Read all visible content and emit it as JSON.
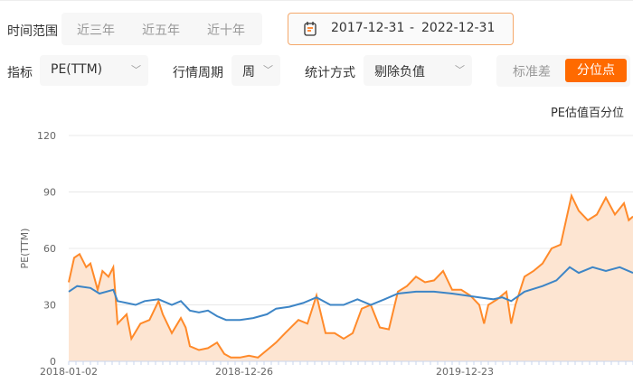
{
  "filters": {
    "time_range_label": "时间范围",
    "range_options": [
      "近三年",
      "近五年",
      "近十年"
    ],
    "date_start": "2017-12-31",
    "date_sep": "-",
    "date_end": "2022-12-31",
    "calendar_icon": "calendar-icon",
    "indicator_label": "指标",
    "indicator_value": "PE(TTM)",
    "period_label": "行情周期",
    "period_value": "周",
    "stat_label": "统计方式",
    "stat_value": "剔除负值",
    "toggle_options": [
      "标准差",
      "分位点"
    ],
    "toggle_active": "分位点"
  },
  "colors": {
    "accent": "#ff6a00",
    "pe": "#3d85c6",
    "percentile": "#ff8a2a",
    "fill": "#fde5d2"
  },
  "chart_data": {
    "type": "line",
    "title": "PE估值百分位",
    "ylabel": "PE(TTM)",
    "ylim": [
      0,
      120
    ],
    "yticks": [
      0,
      30,
      60,
      90,
      120
    ],
    "xlim": [
      0,
      936
    ],
    "xticks": [
      {
        "x": 0,
        "label": "2018-01-02"
      },
      {
        "x": 291,
        "label": "2018-12-26"
      },
      {
        "x": 657,
        "label": "2019-12-23"
      }
    ],
    "series": [
      {
        "name": "PE估值百分位",
        "type": "area",
        "points": [
          [
            0,
            42
          ],
          [
            9,
            55
          ],
          [
            18,
            57
          ],
          [
            29,
            50
          ],
          [
            36,
            52
          ],
          [
            48,
            38
          ],
          [
            56,
            48
          ],
          [
            66,
            45
          ],
          [
            74,
            50
          ],
          [
            78,
            33
          ],
          [
            81,
            20
          ],
          [
            96,
            25
          ],
          [
            104,
            12
          ],
          [
            119,
            20
          ],
          [
            134,
            22
          ],
          [
            149,
            32
          ],
          [
            156,
            25
          ],
          [
            171,
            15
          ],
          [
            186,
            23
          ],
          [
            194,
            18
          ],
          [
            201,
            8
          ],
          [
            216,
            6
          ],
          [
            231,
            7
          ],
          [
            246,
            10
          ],
          [
            258,
            4
          ],
          [
            269,
            2
          ],
          [
            284,
            2
          ],
          [
            299,
            3
          ],
          [
            314,
            2
          ],
          [
            329,
            6
          ],
          [
            344,
            10
          ],
          [
            359,
            15
          ],
          [
            381,
            22
          ],
          [
            396,
            20
          ],
          [
            411,
            35
          ],
          [
            426,
            15
          ],
          [
            441,
            15
          ],
          [
            456,
            12
          ],
          [
            471,
            15
          ],
          [
            486,
            28
          ],
          [
            501,
            30
          ],
          [
            516,
            18
          ],
          [
            531,
            17
          ],
          [
            546,
            37
          ],
          [
            561,
            40
          ],
          [
            576,
            45
          ],
          [
            591,
            42
          ],
          [
            606,
            43
          ],
          [
            621,
            48
          ],
          [
            636,
            38
          ],
          [
            651,
            38
          ],
          [
            666,
            35
          ],
          [
            681,
            30
          ],
          [
            689,
            20
          ],
          [
            696,
            30
          ],
          [
            711,
            33
          ],
          [
            726,
            37
          ],
          [
            734,
            20
          ],
          [
            741,
            30
          ],
          [
            756,
            45
          ],
          [
            771,
            48
          ],
          [
            786,
            52
          ],
          [
            801,
            60
          ],
          [
            816,
            62
          ],
          [
            834,
            88
          ],
          [
            846,
            80
          ],
          [
            861,
            75
          ],
          [
            876,
            78
          ],
          [
            891,
            87
          ],
          [
            906,
            78
          ],
          [
            921,
            84
          ],
          [
            929,
            75
          ],
          [
            936,
            77
          ]
        ]
      },
      {
        "name": "PE(TTM)",
        "type": "line",
        "points": [
          [
            0,
            37
          ],
          [
            14,
            40
          ],
          [
            36,
            39
          ],
          [
            51,
            36
          ],
          [
            74,
            38
          ],
          [
            81,
            32
          ],
          [
            96,
            31
          ],
          [
            111,
            30
          ],
          [
            126,
            32
          ],
          [
            149,
            33
          ],
          [
            171,
            30
          ],
          [
            186,
            32
          ],
          [
            201,
            27
          ],
          [
            216,
            26
          ],
          [
            231,
            27
          ],
          [
            246,
            24
          ],
          [
            261,
            22
          ],
          [
            284,
            22
          ],
          [
            306,
            23
          ],
          [
            329,
            25
          ],
          [
            344,
            28
          ],
          [
            366,
            29
          ],
          [
            389,
            31
          ],
          [
            411,
            34
          ],
          [
            434,
            30
          ],
          [
            456,
            30
          ],
          [
            479,
            33
          ],
          [
            501,
            30
          ],
          [
            524,
            33
          ],
          [
            546,
            36
          ],
          [
            576,
            37
          ],
          [
            606,
            37
          ],
          [
            636,
            36
          ],
          [
            659,
            35
          ],
          [
            681,
            34
          ],
          [
            704,
            33
          ],
          [
            719,
            34
          ],
          [
            734,
            32
          ],
          [
            756,
            37
          ],
          [
            786,
            40
          ],
          [
            809,
            43
          ],
          [
            831,
            50
          ],
          [
            846,
            47
          ],
          [
            869,
            50
          ],
          [
            891,
            48
          ],
          [
            914,
            50
          ],
          [
            936,
            47
          ]
        ]
      }
    ]
  }
}
